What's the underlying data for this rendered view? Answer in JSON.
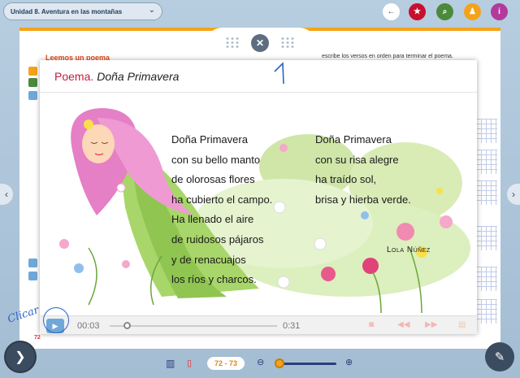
{
  "topbar": {
    "unit_label": "Unidad 8. Aventura en las montañas",
    "buttons": [
      {
        "name": "back-button",
        "glyph": "←",
        "color": "#ffffff",
        "fg": "#3b4c60"
      },
      {
        "name": "star-button",
        "glyph": "★",
        "color": "#c8102e"
      },
      {
        "name": "search-button",
        "glyph": "⌕",
        "color": "#4a8a3a"
      },
      {
        "name": "user-button",
        "glyph": "♟",
        "color": "#f3a31b"
      },
      {
        "name": "info-button",
        "glyph": "i",
        "color": "#b23a9c"
      }
    ]
  },
  "background_page": {
    "section_title": "Leemos un poema",
    "right_instruction": "escribe los versos en orden para terminar el poema."
  },
  "modal": {
    "title_prefix": "Poema.",
    "title_name": "Doña Primavera",
    "poem_left": [
      "Doña Primavera",
      "con su bello manto",
      "de olorosas flores",
      "ha cubierto el campo.",
      "Ha llenado el aire",
      "de ruidosos pájaros",
      "y de renacuajos",
      "los ríos y charcos."
    ],
    "poem_right": [
      "Doña Primavera",
      "con su risa alegre",
      "ha traído sol,",
      "brisa y hierba verde."
    ],
    "author": "Lola Núñez"
  },
  "player": {
    "current_time": "00:03",
    "total_time": "0:31",
    "progress_fraction": 0.1
  },
  "annotations": {
    "handwritten_clicar": "Clicar",
    "handwritten_number": "1"
  },
  "bottom": {
    "pages": "72 - 73",
    "page_number_left": "72",
    "zoom_fraction": 0.05
  },
  "colors": {
    "accent_orange": "#f3a31b",
    "title_red": "#c21e3a",
    "navy": "#3b4c60"
  }
}
